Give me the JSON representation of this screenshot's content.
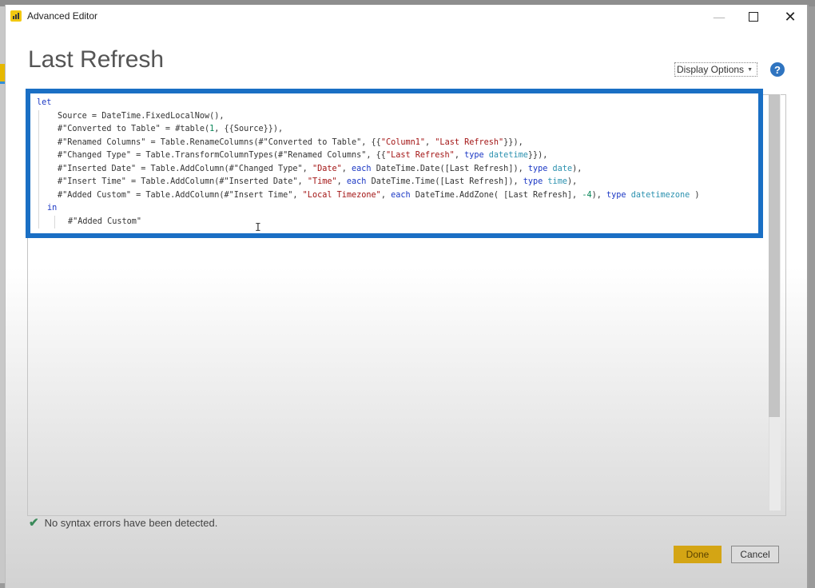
{
  "window": {
    "title": "Advanced Editor",
    "minimize_label": "—",
    "maximize_label": "",
    "close_label": "✕"
  },
  "header": {
    "query_name": "Last Refresh",
    "display_options_label": "Display Options",
    "display_options_caret": "▼",
    "help_label": "?"
  },
  "editor": {
    "lines": [
      {
        "indent": 0,
        "tokens": [
          {
            "t": "let",
            "c": "kw"
          }
        ]
      },
      {
        "indent": 1,
        "tokens": [
          {
            "t": "Source = DateTime.FixedLocalNow(),",
            "c": ""
          }
        ]
      },
      {
        "indent": 1,
        "tokens": [
          {
            "t": "#\"Converted to Table\" = #table(",
            "c": ""
          },
          {
            "t": "1",
            "c": "num"
          },
          {
            "t": ", {{Source}}),",
            "c": ""
          }
        ]
      },
      {
        "indent": 1,
        "tokens": [
          {
            "t": "#\"Renamed Columns\" = Table.RenameColumns(#\"Converted to Table\", {{",
            "c": ""
          },
          {
            "t": "\"Column1\"",
            "c": "str"
          },
          {
            "t": ", ",
            "c": ""
          },
          {
            "t": "\"Last Refresh\"",
            "c": "str"
          },
          {
            "t": "}}),",
            "c": ""
          }
        ]
      },
      {
        "indent": 1,
        "tokens": [
          {
            "t": "#\"Changed Type\" = Table.TransformColumnTypes(#\"Renamed Columns\", {{",
            "c": ""
          },
          {
            "t": "\"Last Refresh\"",
            "c": "str"
          },
          {
            "t": ", ",
            "c": ""
          },
          {
            "t": "type",
            "c": "kw"
          },
          {
            "t": " ",
            "c": ""
          },
          {
            "t": "datetime",
            "c": "typ"
          },
          {
            "t": "}}),",
            "c": ""
          }
        ]
      },
      {
        "indent": 1,
        "tokens": [
          {
            "t": "#\"Inserted Date\" = Table.AddColumn(#\"Changed Type\", ",
            "c": ""
          },
          {
            "t": "\"Date\"",
            "c": "str"
          },
          {
            "t": ", ",
            "c": ""
          },
          {
            "t": "each",
            "c": "kw"
          },
          {
            "t": " DateTime.Date([Last Refresh]), ",
            "c": ""
          },
          {
            "t": "type",
            "c": "kw"
          },
          {
            "t": " ",
            "c": ""
          },
          {
            "t": "date",
            "c": "typ"
          },
          {
            "t": "),",
            "c": ""
          }
        ]
      },
      {
        "indent": 1,
        "tokens": [
          {
            "t": "#\"Insert Time\" = Table.AddColumn(#\"Inserted Date\", ",
            "c": ""
          },
          {
            "t": "\"Time\"",
            "c": "str"
          },
          {
            "t": ", ",
            "c": ""
          },
          {
            "t": "each",
            "c": "kw"
          },
          {
            "t": " DateTime.Time([Last Refresh]), ",
            "c": ""
          },
          {
            "t": "type",
            "c": "kw"
          },
          {
            "t": " ",
            "c": ""
          },
          {
            "t": "time",
            "c": "typ"
          },
          {
            "t": "),",
            "c": ""
          }
        ]
      },
      {
        "indent": 1,
        "tokens": [
          {
            "t": "#\"Added Custom\" = Table.AddColumn(#\"Insert Time\", ",
            "c": ""
          },
          {
            "t": "\"Local Timezone\"",
            "c": "str"
          },
          {
            "t": ", ",
            "c": ""
          },
          {
            "t": "each",
            "c": "kw"
          },
          {
            "t": " DateTime.AddZone( [Last Refresh], ",
            "c": ""
          },
          {
            "t": "-4",
            "c": "num"
          },
          {
            "t": "), ",
            "c": ""
          },
          {
            "t": "type",
            "c": "kw"
          },
          {
            "t": " ",
            "c": ""
          },
          {
            "t": "datetimezone",
            "c": "typ"
          },
          {
            "t": " )",
            "c": ""
          }
        ]
      },
      {
        "indent": 0.5,
        "tokens": [
          {
            "t": "in",
            "c": "kw"
          }
        ]
      },
      {
        "indent": 1.5,
        "tokens": [
          {
            "t": "#\"Added Custom\"",
            "c": ""
          }
        ]
      }
    ]
  },
  "status": {
    "icon": "✔",
    "message": "No syntax errors have been detected."
  },
  "footer": {
    "done_label": "Done",
    "cancel_label": "Cancel"
  },
  "colors": {
    "highlight_border": "#1a6fc4",
    "done_button": "#d4a514",
    "help_icon": "#2f74c0",
    "keyword": "#1a37c4",
    "string": "#a31515",
    "number": "#098658",
    "type": "#2b91af"
  }
}
